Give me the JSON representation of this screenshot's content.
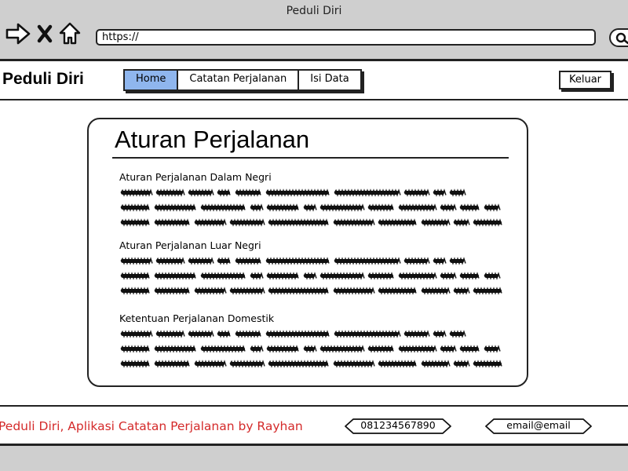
{
  "browser": {
    "title": "Peduli Diri",
    "url": "https://"
  },
  "header": {
    "brand": "Peduli Diri",
    "tabs": [
      {
        "label": "Home",
        "active": true
      },
      {
        "label": "Catatan Perjalanan",
        "active": false
      },
      {
        "label": "Isi Data",
        "active": false
      }
    ],
    "logout_label": "Keluar"
  },
  "main": {
    "title": "Aturan Perjalanan",
    "sections": [
      {
        "heading": "Aturan Perjalanan Dalam Negri"
      },
      {
        "heading": "Aturan Perjalanan Luar Negri"
      },
      {
        "heading": "Ketentuan Perjalanan Domestik"
      }
    ]
  },
  "footer": {
    "text": "Peduli Diri, Aplikasi Catatan Perjalanan by Rayhan",
    "phone": "081234567890",
    "email": "email@email"
  },
  "colors": {
    "active_tab": "#8fb6ee",
    "footer_text": "#d42a2a",
    "chrome": "#cfcfcf"
  }
}
